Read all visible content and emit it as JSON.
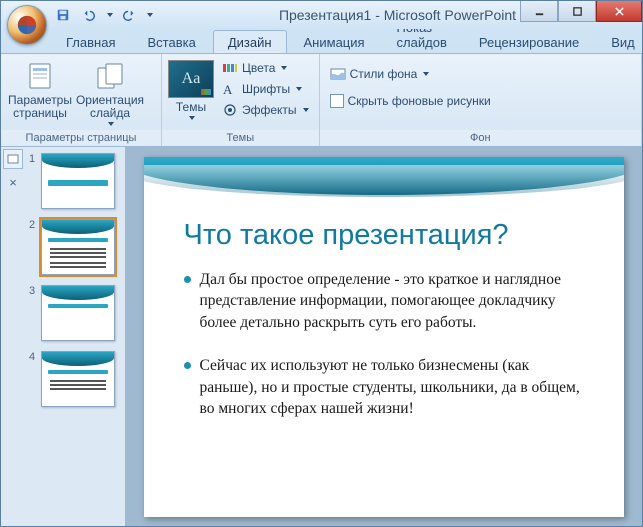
{
  "window": {
    "title": "Презентация1 - Microsoft PowerPoint"
  },
  "qat": {
    "save": "save-icon",
    "undo": "undo-icon",
    "redo": "redo-icon"
  },
  "tabs": [
    {
      "id": "home",
      "label": "Главная"
    },
    {
      "id": "insert",
      "label": "Вставка"
    },
    {
      "id": "design",
      "label": "Дизайн"
    },
    {
      "id": "anim",
      "label": "Анимация"
    },
    {
      "id": "show",
      "label": "Показ слайдов"
    },
    {
      "id": "review",
      "label": "Рецензирование"
    },
    {
      "id": "view",
      "label": "Вид"
    }
  ],
  "active_tab": "design",
  "ribbon": {
    "page_setup": {
      "page_params": "Параметры\nстраницы",
      "orientation": "Ориентация\nслайда",
      "group_label": "Параметры страницы"
    },
    "themes": {
      "themes_btn": "Темы",
      "colors": "Цвета",
      "fonts": "Шрифты",
      "effects": "Эффекты",
      "group_label": "Темы",
      "thumb_text": "Aa"
    },
    "background": {
      "styles": "Стили фона",
      "hide_graphics": "Скрыть фоновые рисунки",
      "group_label": "Фон"
    }
  },
  "thumbnails": [
    {
      "n": "1"
    },
    {
      "n": "2"
    },
    {
      "n": "3"
    },
    {
      "n": "4"
    }
  ],
  "selected_thumb": 2,
  "slide": {
    "title": "Что такое презентация?",
    "bullets": [
      "Дал бы простое определение - это краткое и наглядное представление информации, помогающее докладчику более детально раскрыть суть его работы.",
      "Сейчас их используют не только бизнесмены (как раньше), но и простые студенты, школьники, да в общем, во многих сферах нашей жизни!"
    ]
  },
  "outline_close": "×"
}
